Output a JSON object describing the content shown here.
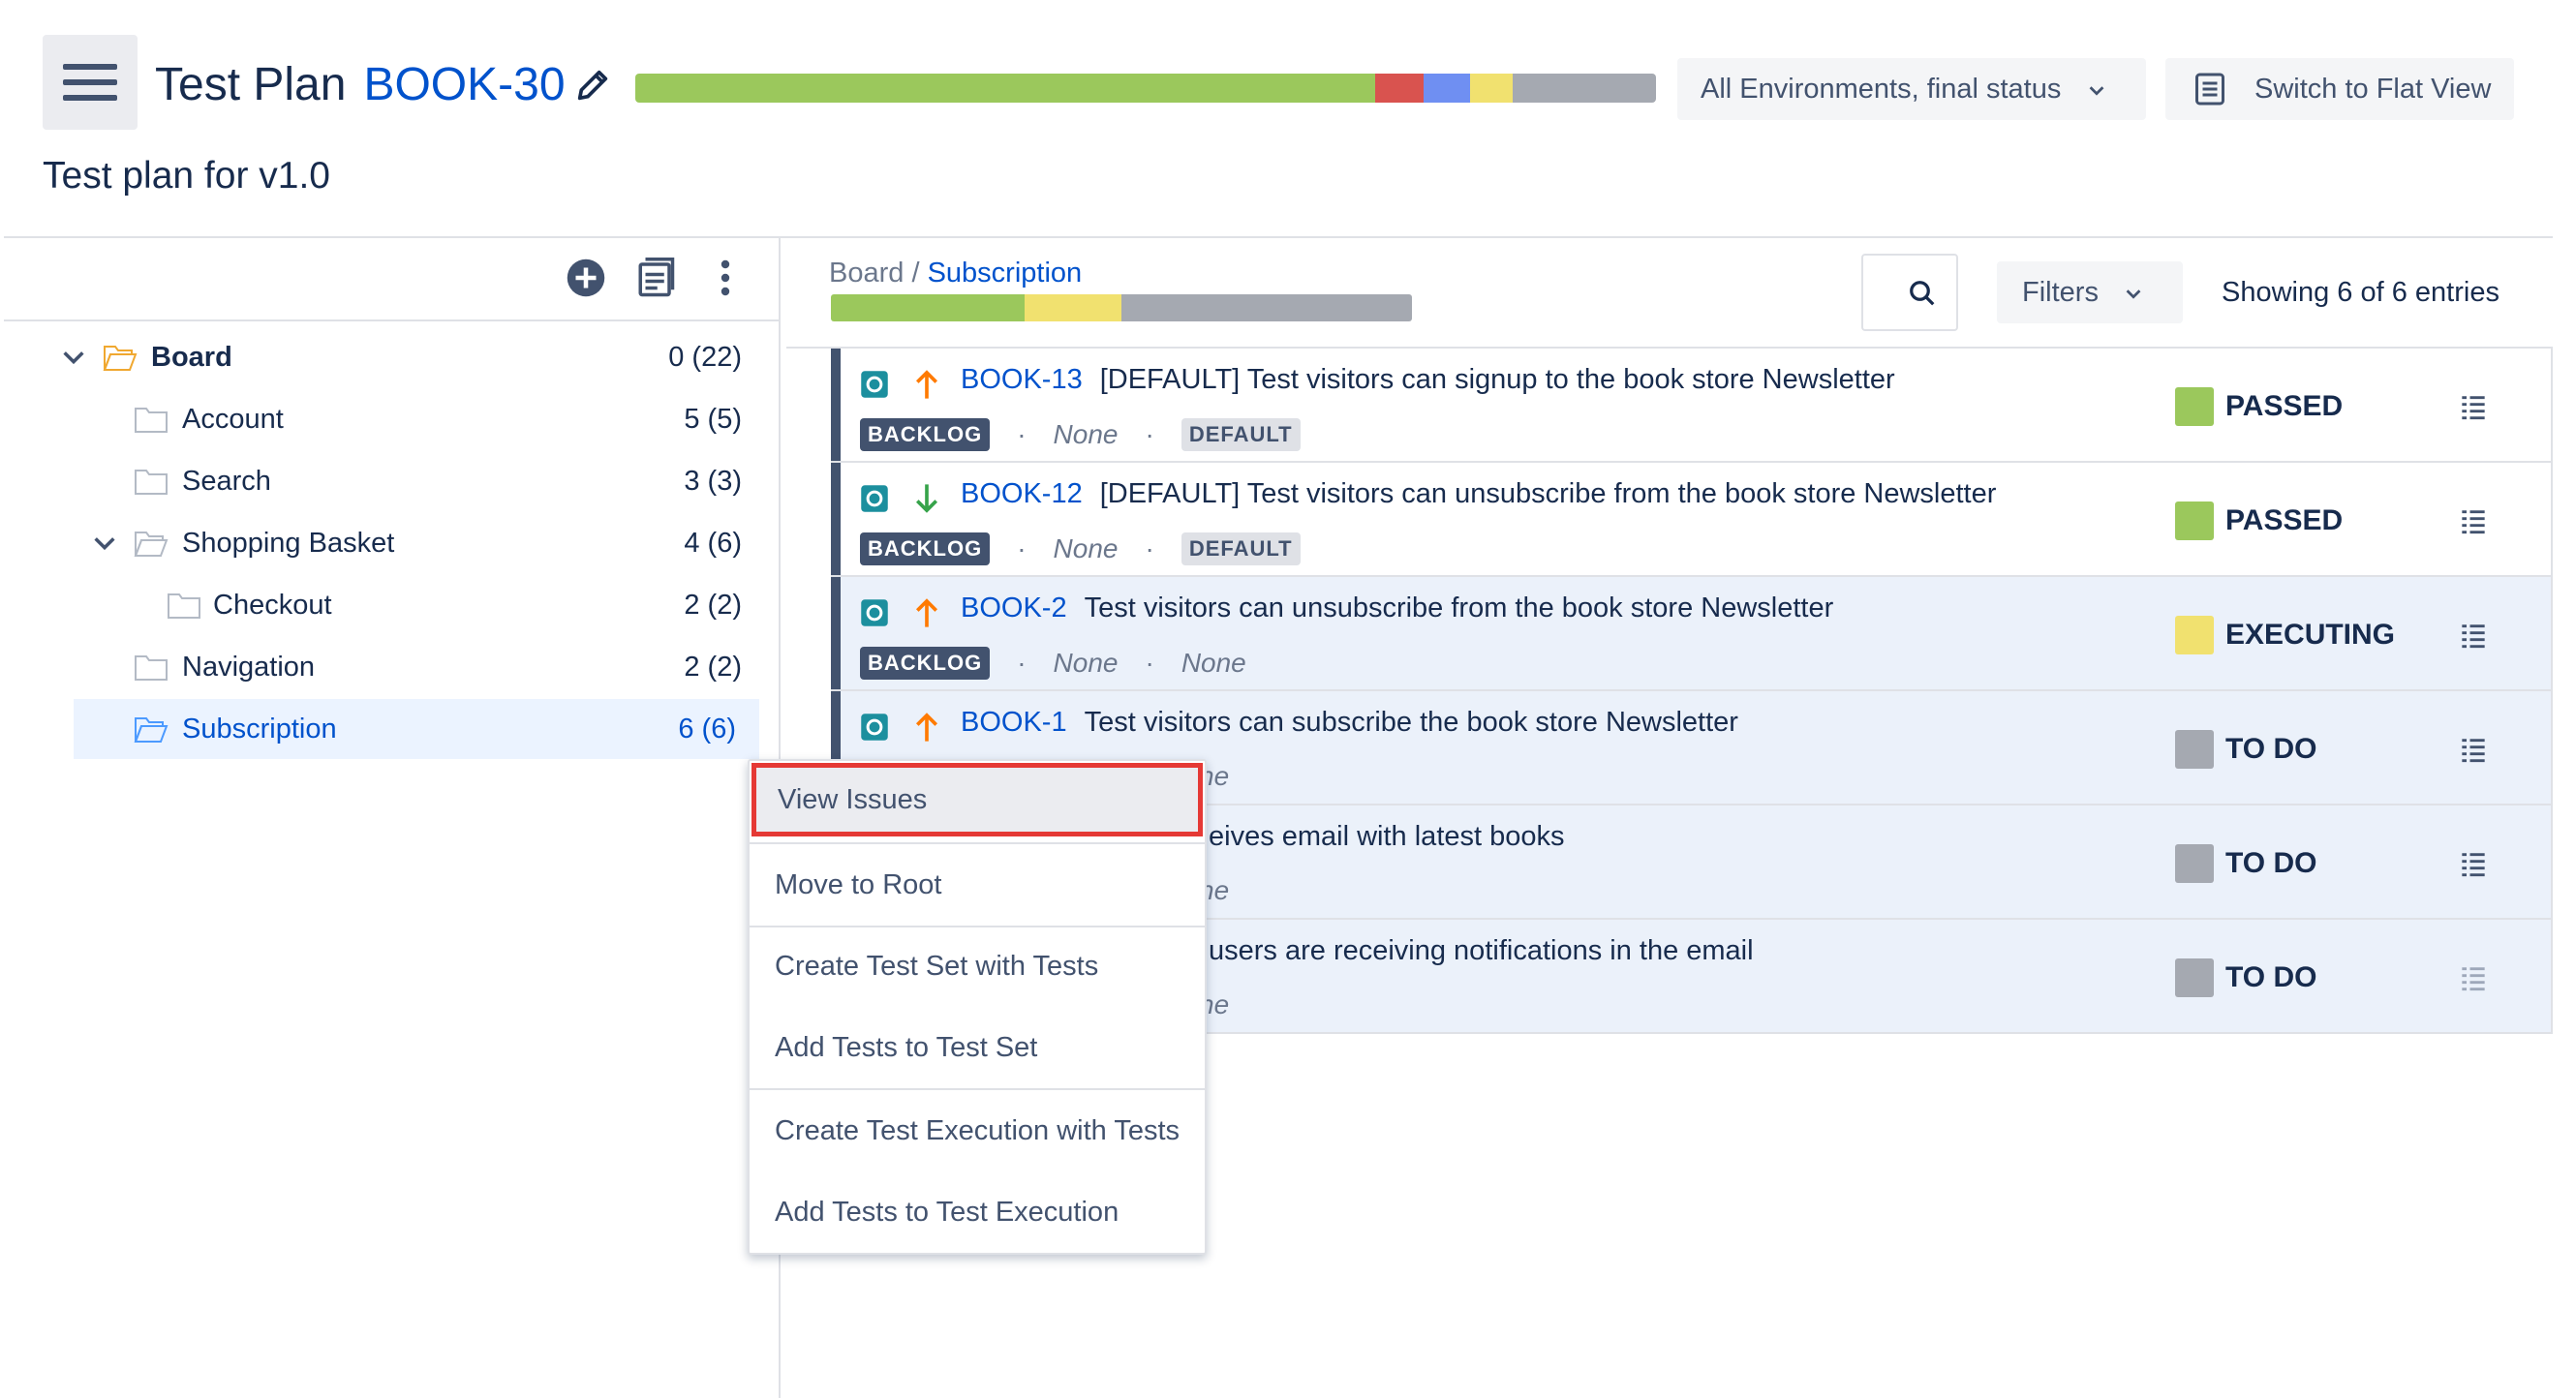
{
  "header": {
    "title_label": "Test Plan",
    "title_key": "BOOK-30",
    "subtitle": "Test plan for v1.0",
    "environment_select": "All Environments, final status",
    "flat_view_label": "Switch to Flat View",
    "progress_colors": [
      "#9bc85c",
      "#d9534f",
      "#6f8ff2",
      "#f1e16f",
      "#a5a9b1"
    ]
  },
  "tree": {
    "items": [
      {
        "label": "Board",
        "count": "0 (22)"
      },
      {
        "label": "Account",
        "count": "5 (5)"
      },
      {
        "label": "Search",
        "count": "3 (3)"
      },
      {
        "label": "Shopping Basket",
        "count": "4 (6)"
      },
      {
        "label": "Checkout",
        "count": "2 (2)"
      },
      {
        "label": "Navigation",
        "count": "2 (2)"
      },
      {
        "label": "Subscription",
        "count": "6 (6)"
      }
    ]
  },
  "right": {
    "breadcrumb_root": "Board",
    "breadcrumb_sep": " / ",
    "breadcrumb_current": "Subscription",
    "filters_label": "Filters",
    "showing": "Showing 6 of 6 entries"
  },
  "tests": [
    {
      "key": "BOOK-13",
      "summary": "[DEFAULT] Test visitors can signup to the book store Newsletter",
      "badge": "BACKLOG",
      "meta1": "None",
      "meta2": "DEFAULT",
      "status": "PASSED",
      "status_color": "#9bc85c",
      "priority": "high"
    },
    {
      "key": "BOOK-12",
      "summary": "[DEFAULT] Test visitors can unsubscribe from the book store Newsletter",
      "badge": "BACKLOG",
      "meta1": "None",
      "meta2": "DEFAULT",
      "status": "PASSED",
      "status_color": "#9bc85c",
      "priority": "low"
    },
    {
      "key": "BOOK-2",
      "summary": "Test visitors can unsubscribe from the book store Newsletter",
      "badge": "BACKLOG",
      "meta1": "None",
      "meta2": "None",
      "status": "EXECUTING",
      "status_color": "#f1e16f",
      "priority": "high"
    },
    {
      "key": "BOOK-1",
      "summary": "Test visitors can subscribe the book store Newsletter",
      "meta1": "ne",
      "status": "TO DO",
      "status_color": "#a5a9b1",
      "priority": "high"
    },
    {
      "summary": "eives email with latest books",
      "meta1": "ne",
      "status": "TO DO",
      "status_color": "#a5a9b1"
    },
    {
      "summary": "users are receiving notifications in the email",
      "meta1": "ne",
      "status": "TO DO",
      "status_color": "#a5a9b1"
    }
  ],
  "context_menu": {
    "items": [
      "View Issues",
      "Move to Root",
      "Create Test Set with Tests",
      "Add Tests to Test Set",
      "Create Test Execution with Tests",
      "Add Tests to Test Execution"
    ]
  }
}
